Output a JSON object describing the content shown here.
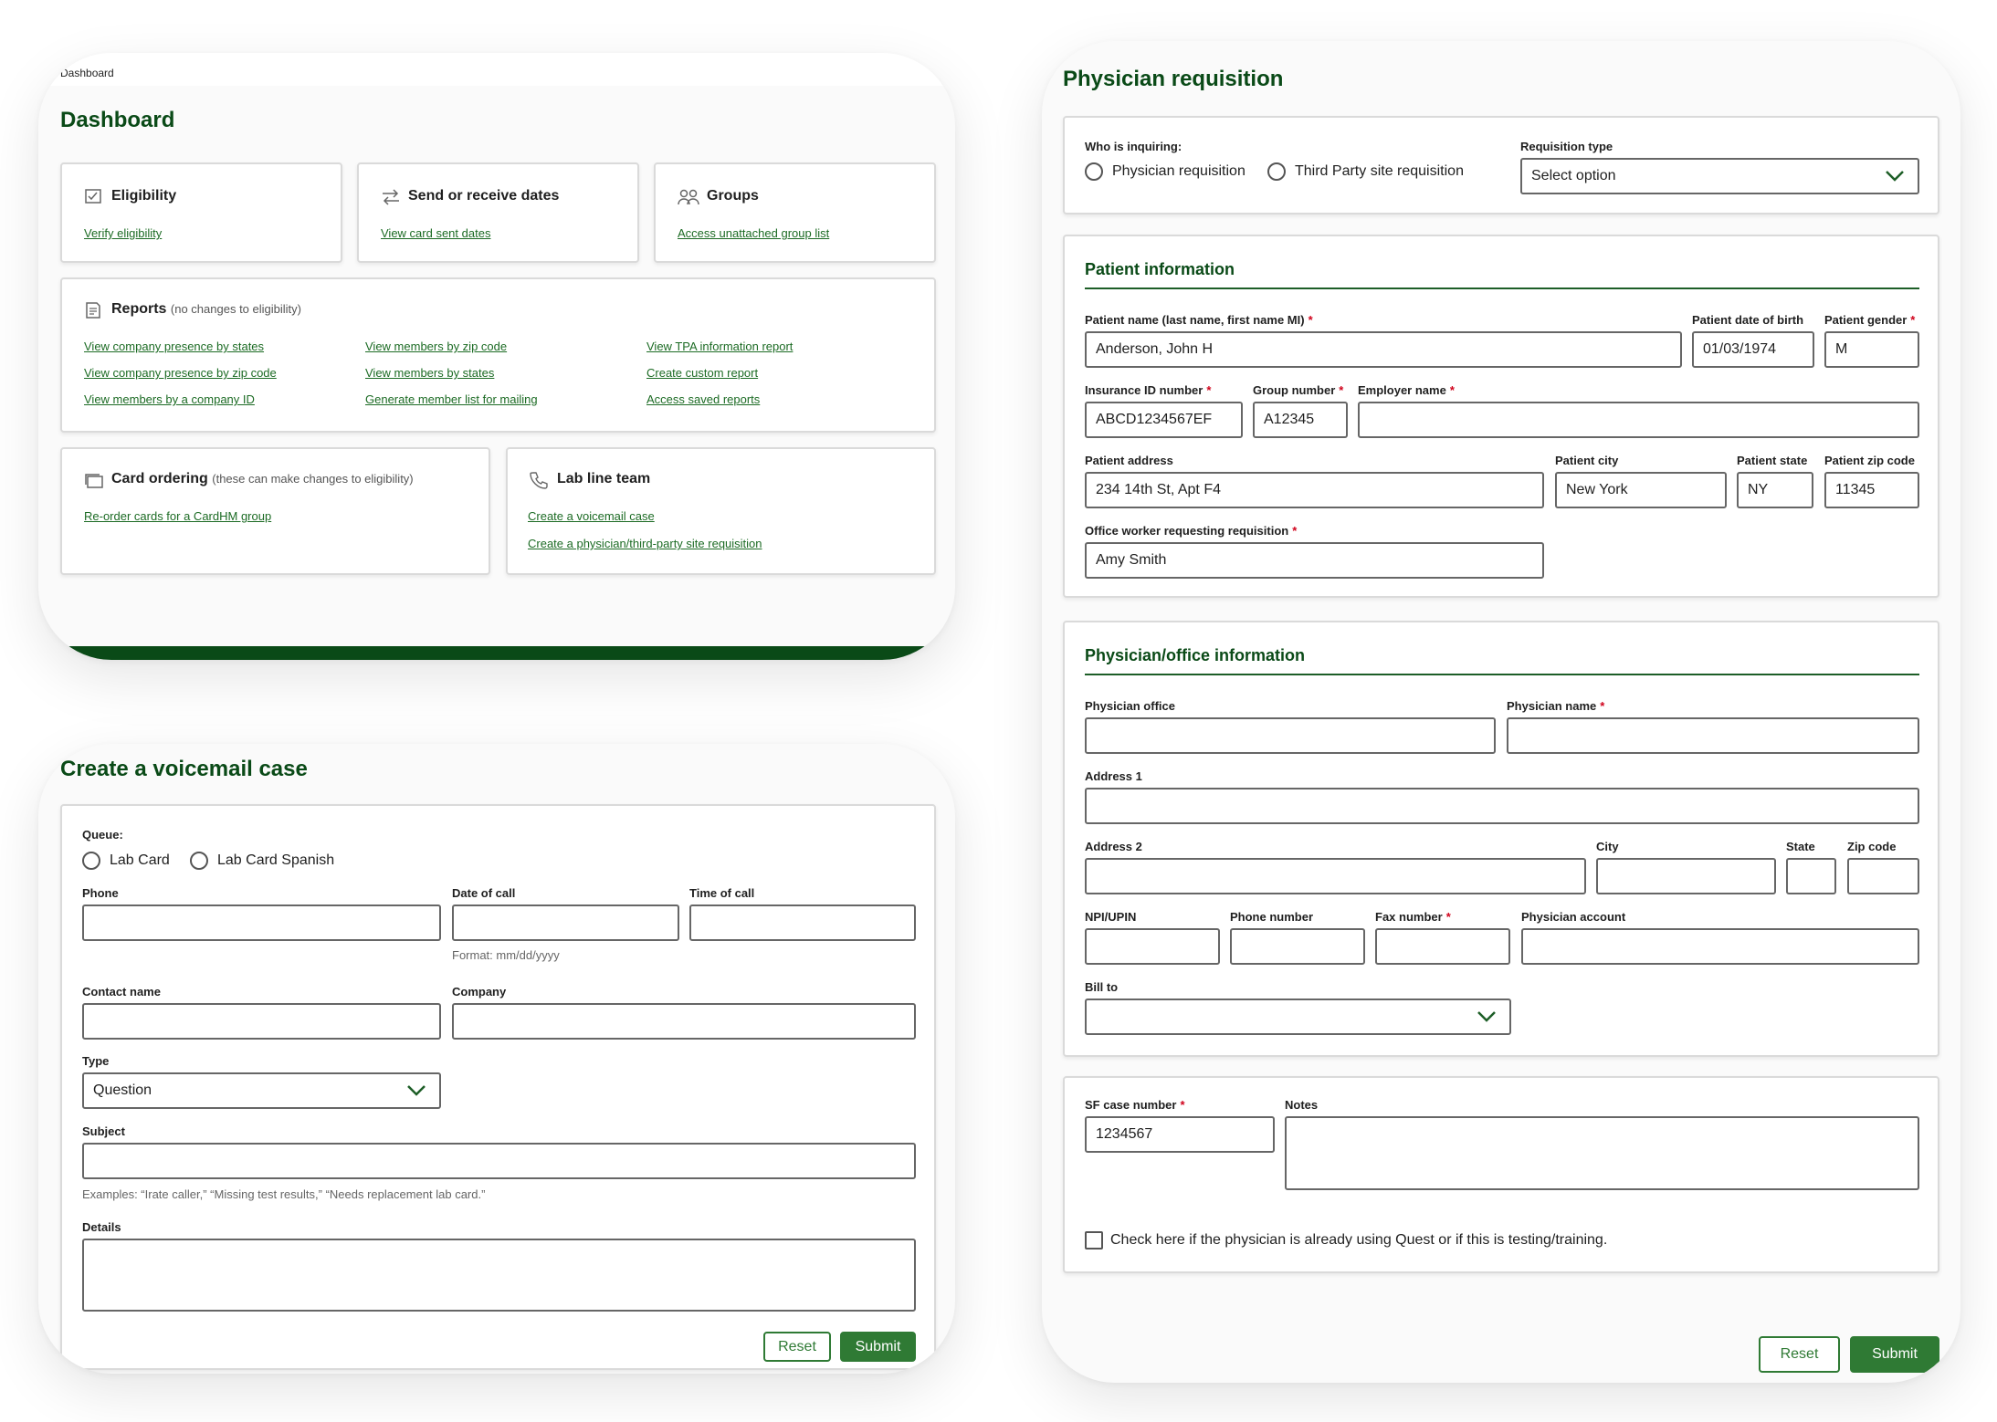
{
  "dashboard": {
    "breadcrumb": "Dashboard",
    "title": "Dashboard",
    "cards": {
      "eligibility": {
        "title": "Eligibility",
        "link": "Verify eligibility"
      },
      "dates": {
        "title": "Send or receive dates",
        "link": "View card sent dates"
      },
      "groups": {
        "title": "Groups",
        "link": "Access unattached group list"
      }
    },
    "reports": {
      "title": "Reports",
      "note": "(no changes to eligibility)",
      "links": [
        "View company presence by states",
        "View company presence by zip code",
        "View members by a company ID",
        "View members by zip code",
        "View members by states",
        "Generate member list for mailing",
        "View TPA information report",
        "Create custom report",
        "Access saved reports"
      ]
    },
    "card_ordering": {
      "title": "Card ordering",
      "note": "(these can make changes to eligibility)",
      "link": "Re-order cards for a CardHM group"
    },
    "lab_line": {
      "title": "Lab line team",
      "links": [
        "Create a voicemail case",
        "Create a physician/third-party site requisition"
      ]
    }
  },
  "voicemail": {
    "title": "Create a voicemail case",
    "queue_label": "Queue:",
    "queue_options": [
      "Lab Card",
      "Lab Card Spanish"
    ],
    "phone_label": "Phone",
    "date_label": "Date of call",
    "time_label": "Time of call",
    "date_hint": "Format: mm/dd/yyyy",
    "contact_label": "Contact name",
    "company_label": "Company",
    "type_label": "Type",
    "type_value": "Question",
    "subject_label": "Subject",
    "subject_hint": "Examples: “Irate caller,” “Missing test results,” “Needs replacement lab card.”",
    "details_label": "Details",
    "reset": "Reset",
    "submit": "Submit"
  },
  "requisition": {
    "title": "Physician requisition",
    "who_label": "Who is inquiring:",
    "who_options": [
      "Physician requisition",
      "Third Party site requisition"
    ],
    "type_label": "Requisition type",
    "type_placeholder": "Select option",
    "patient": {
      "section": "Patient information",
      "name_label": "Patient name (last name, first name MI)",
      "name_value": "Anderson, John H",
      "dob_label": "Patient date of birth",
      "dob_value": "01/03/1974",
      "gender_label": "Patient gender",
      "gender_value": "M",
      "insurance_label": "Insurance ID number",
      "insurance_value": "ABCD1234567EF",
      "group_label": "Group number",
      "group_value": "A12345",
      "employer_label": "Employer name",
      "employer_value": "",
      "address_label": "Patient address",
      "address_value": "234 14th St, Apt F4",
      "city_label": "Patient city",
      "city_value": "New York",
      "state_label": "Patient state",
      "state_value": "NY",
      "zip_label": "Patient zip code",
      "zip_value": "11345",
      "worker_label": "Office worker requesting requisition",
      "worker_value": "Amy Smith"
    },
    "physician": {
      "section": "Physician/office information",
      "office_label": "Physician office",
      "name_label": "Physician name",
      "address1_label": "Address 1",
      "address2_label": "Address 2",
      "city_label": "City",
      "state_label": "State",
      "zip_label": "Zip code",
      "npi_label": "NPI/UPIN",
      "phone_label": "Phone number",
      "fax_label": "Fax number",
      "account_label": "Physician account",
      "billto_label": "Bill to"
    },
    "sf_label": "SF case number",
    "sf_value": "1234567",
    "notes_label": "Notes",
    "checkbox_label": "Check here if the physician is already using Quest or if this is testing/training.",
    "reset": "Reset",
    "submit": "Submit"
  }
}
